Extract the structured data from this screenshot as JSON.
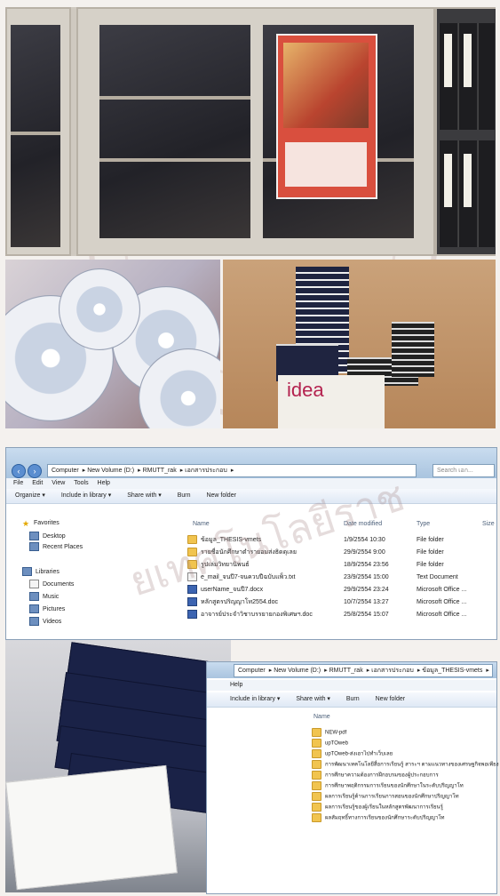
{
  "poster": {
    "alt": "wall poster"
  },
  "idea_box": {
    "text": "idea"
  },
  "win1": {
    "address": [
      "Computer",
      "New Volume (D:)",
      "RMUTT_rak",
      "เอกสารประกอบ"
    ],
    "search_placeholder": "Search เอก...",
    "menu": [
      "File",
      "Edit",
      "View",
      "Tools",
      "Help"
    ],
    "toolbar": [
      "Organize ▾",
      "Include in library ▾",
      "Share with ▾",
      "Burn",
      "New folder"
    ],
    "nav": {
      "favorites": "Favorites",
      "desktop": "Desktop",
      "recent": "Recent Places",
      "libraries": "Libraries",
      "documents": "Documents",
      "music": "Music",
      "pictures": "Pictures",
      "videos": "Videos"
    },
    "columns": {
      "name": "Name",
      "date": "Date modified",
      "type": "Type",
      "size": "Size"
    },
    "files": [
      {
        "icon": "folder",
        "name": "ข้อมูล_THESIS-vmets",
        "date": "1/9/2554 10:30",
        "type": "File folder"
      },
      {
        "icon": "folder",
        "name": "รายชื่อนักศึกษาตำรายอมส่งธิดดุเลย",
        "date": "29/9/2554 9:00",
        "type": "File folder"
      },
      {
        "icon": "folder",
        "name": "รูปเล่มวิทยานิพนธ์",
        "date": "18/9/2554 23:56",
        "type": "File folder"
      },
      {
        "icon": "txt",
        "name": "e_mail_จนปี7-จนควบปีฉบับแพ็ว.txt",
        "date": "23/9/2554 15:00",
        "type": "Text Document"
      },
      {
        "icon": "doc",
        "name": "userName_จนปี7.docx",
        "date": "29/9/2554 23:24",
        "type": "Microsoft Office ..."
      },
      {
        "icon": "doc",
        "name": "หลักสูตรปริญญาโท2554.doc",
        "date": "10/7/2554 13:27",
        "type": "Microsoft Office ..."
      },
      {
        "icon": "doc",
        "name": "อาจารย์ประจำวิชาบรรยายกองพิเศษฯ.doc",
        "date": "25/8/2554 15:07",
        "type": "Microsoft Office ..."
      }
    ]
  },
  "win2": {
    "address": [
      "Computer",
      "New Volume (D:)",
      "RMUTT_rak",
      "เอกสารประกอบ",
      "ข้อมูล_THESIS-vmets"
    ],
    "menu": [
      "Help"
    ],
    "toolbar": [
      "Include in library ▾",
      "Share with ▾",
      "Burn",
      "New folder"
    ],
    "column_name": "Name",
    "rows": [
      "NEW-pdf",
      "upTOweb",
      "upTOweb-ส่งเอาไปทำเว็บเลย",
      "การพัฒนาเทคโนโลยีสื่อการเรียนรู้ สาระฯ ตามแนวทางของเศรษฐกิจพอเพียง",
      "การศึกษาความต้องการฝึกอบรมของผู้ประกอบการ",
      "การศึกษาพฤติกรรมการเรียนของนักศึกษาในระดับปริญญาโท",
      "ผลการเรียนรู้ด้านการเรียนการสอนของนักศึกษาปริญญาโท",
      "ผลการเรียนรู้ของผู้เรียนในหลักสูตรพัฒนาการเรียนรู้",
      "ผลสัมฤทธิ์ทางการเรียนของนักศึกษาระดับปริญญาโท"
    ]
  },
  "watermark": {
    "text": "ยเทคโนโลยีราช"
  }
}
